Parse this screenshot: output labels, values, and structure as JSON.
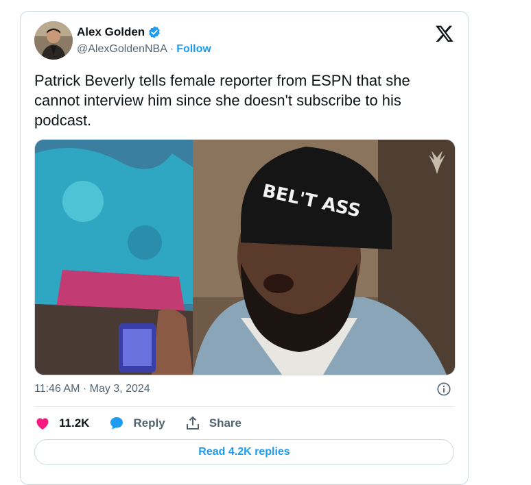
{
  "author": {
    "name": "Alex Golden",
    "handle": "@AlexGoldenNBA",
    "separator": "·",
    "follow_label": "Follow"
  },
  "tweet": {
    "text": "Patrick Beverly tells female reporter from ESPN that she cannot interview him since she doesn't subscribe to his podcast.",
    "media_overlay_text": "BEL'T ASS",
    "timestamp": "11:46 AM · May 3, 2024"
  },
  "actions": {
    "likes": "11.2K",
    "reply_label": "Reply",
    "share_label": "Share"
  },
  "replies_button": "Read 4.2K replies",
  "colors": {
    "accent": "#1d9bf0",
    "like": "#f91880",
    "text": "#0f1419",
    "muted": "#536471"
  }
}
